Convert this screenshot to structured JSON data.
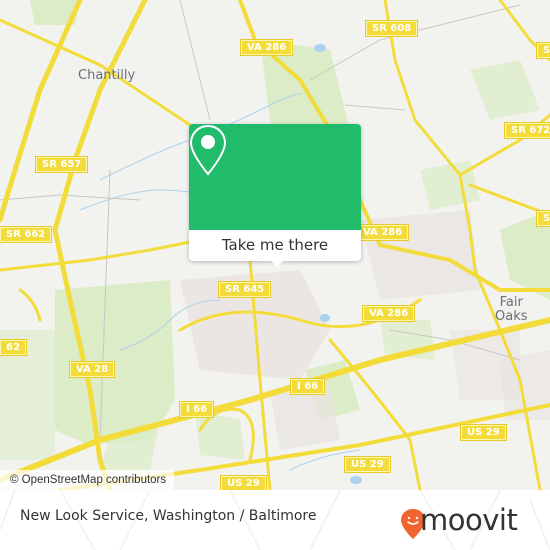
{
  "map": {
    "places": {
      "chantilly": "Chantilly",
      "fair_oaks": "Fair\nOaks"
    },
    "road_shields": {
      "va_286_top": "VA 286",
      "sr_608": "SR 608",
      "sr_672": "SR 672",
      "sr_657": "SR 657",
      "sr_662": "SR 662",
      "sr_right_edge": "SR",
      "va_286_mid": "VA 286",
      "sr_645": "SR 645",
      "va_286_right": "VA 286",
      "sr_662_left": "62",
      "va_28": "VA 28",
      "i66_left": "I 66",
      "i66_right": "I 66",
      "us29_right": "US 29",
      "us29_bottom": "US 29"
    },
    "popup": {
      "button_label": "Take me there",
      "icon": "map-pin-icon"
    },
    "attribution": "© OpenStreetMap contributors"
  },
  "footer": {
    "title": "New Look Service, Washington / Baltimore",
    "brand": "moovit",
    "brand_color": "#f0642f"
  },
  "colors": {
    "popup_green": "#20bb6b",
    "road_yellow": "#f3dc3a",
    "park_green": "#d9ebc4",
    "water_blue": "#a9d3ef"
  }
}
